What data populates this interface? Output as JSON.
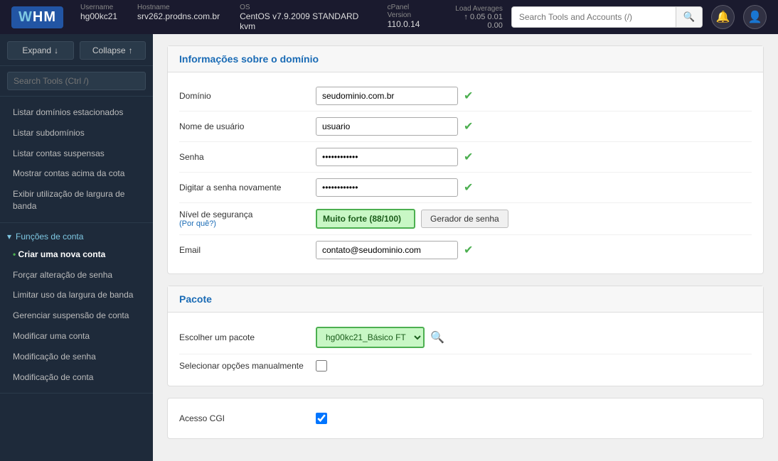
{
  "topbar": {
    "logo": "WHM",
    "username_label": "Username",
    "username_value": "hg00kc21",
    "hostname_label": "Hostname",
    "hostname_value": "srv262.prodns.com.br",
    "os_label": "OS",
    "os_value": "CentOS v7.9.2009 STANDARD kvm",
    "cpanel_label": "cPanel Version",
    "cpanel_value": "110.0.14",
    "load_label": "Load Averages",
    "load_values": "0.05  0.01  0.00",
    "load_arrow": "↑",
    "search_placeholder": "Search Tools and Accounts (/)"
  },
  "sidebar": {
    "expand_label": "Expand",
    "collapse_label": "Collapse",
    "search_placeholder": "Search Tools (Ctrl /)",
    "sections": [
      {
        "label": "",
        "items": [
          {
            "label": "Listar domínios estacionados",
            "active": false
          },
          {
            "label": "Listar subdomínios",
            "active": false
          },
          {
            "label": "Listar contas suspensas",
            "active": false
          },
          {
            "label": "Mostrar contas acima da cota",
            "active": false
          },
          {
            "label": "Exibir utilização de largura de banda",
            "active": false
          }
        ]
      },
      {
        "label": "Funções de conta",
        "items": [
          {
            "label": "Criar uma nova conta",
            "active": true
          },
          {
            "label": "Forçar alteração de senha",
            "active": false
          },
          {
            "label": "Limitar uso da largura de banda",
            "active": false
          },
          {
            "label": "Gerenciar suspensão de conta",
            "active": false
          },
          {
            "label": "Modificar uma conta",
            "active": false
          },
          {
            "label": "Modificação de senha",
            "active": false
          },
          {
            "label": "Modificação de conta",
            "active": false
          }
        ]
      }
    ]
  },
  "main": {
    "sections": [
      {
        "title": "Informações sobre o domínio",
        "fields": [
          {
            "label": "Domínio",
            "type": "text",
            "value": "seudominio.com.br",
            "has_check": true,
            "has_security": false,
            "has_generator": false
          },
          {
            "label": "Nome de usuário",
            "type": "text",
            "value": "usuario",
            "has_check": true,
            "has_security": false,
            "has_generator": false
          },
          {
            "label": "Senha",
            "type": "password",
            "value": "············",
            "has_check": true,
            "has_security": false,
            "has_generator": false
          },
          {
            "label": "Digitar a senha novamente",
            "type": "password",
            "value": "············",
            "has_check": true,
            "has_security": false,
            "has_generator": false
          },
          {
            "label": "Nível de segurança",
            "sublabel": "(Por quê?)",
            "type": "security",
            "value": "Muito forte (88/100)",
            "has_check": false,
            "has_security": true,
            "has_generator": true,
            "generator_label": "Gerador de senha"
          },
          {
            "label": "Email",
            "type": "text",
            "value": "contato@seudominio.com",
            "has_check": true,
            "has_security": false,
            "has_generator": false
          }
        ]
      },
      {
        "title": "Pacote",
        "fields": [
          {
            "label": "Escolher um pacote",
            "type": "select",
            "value": "hg00kc21_Básico FT",
            "has_check": false,
            "has_pkg_search": true
          },
          {
            "label": "Selecionar opções manualmente",
            "type": "checkbox",
            "checked": false
          }
        ]
      },
      {
        "title": "Acesso CGI",
        "fields": [
          {
            "label": "Acesso CGI",
            "type": "checkbox",
            "checked": true
          }
        ]
      }
    ]
  }
}
